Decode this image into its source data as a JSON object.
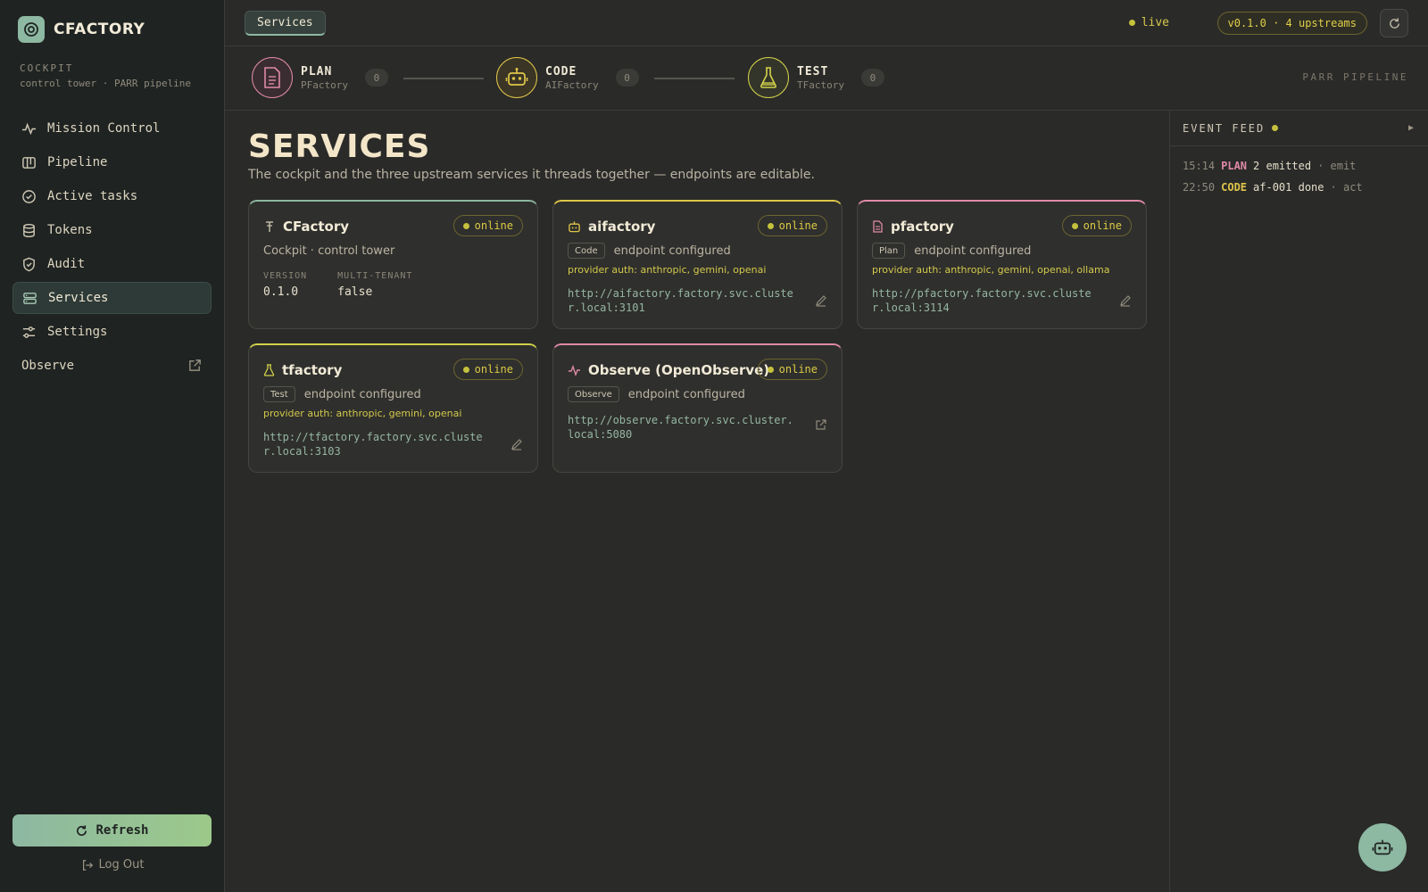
{
  "brand": {
    "name": "CFACTORY"
  },
  "cockpit": {
    "label": "COCKPIT",
    "description": "control tower · PARR pipeline"
  },
  "nav": [
    {
      "label": "Mission Control",
      "icon": "activity-icon"
    },
    {
      "label": "Pipeline",
      "icon": "kanban-icon"
    },
    {
      "label": "Active tasks",
      "icon": "check-circle-icon"
    },
    {
      "label": "Tokens",
      "icon": "database-icon"
    },
    {
      "label": "Audit",
      "icon": "shield-check-icon"
    },
    {
      "label": "Services",
      "icon": "server-icon",
      "active": true
    },
    {
      "label": "Settings",
      "icon": "sliders-icon"
    },
    {
      "label": "Observe",
      "icon": "external-link-icon"
    }
  ],
  "sidebar_footer": {
    "refresh_label": "Refresh",
    "logout_label": "Log Out"
  },
  "topbar": {
    "tab_label": "Services",
    "live_label": "live",
    "version_label": "v0.1.0 · 4 upstreams"
  },
  "pipeline": {
    "label": "PARR PIPELINE",
    "stages": [
      {
        "name": "PLAN",
        "sub": "PFactory",
        "count": "0",
        "color": "#e08aa8",
        "icon": "document-icon"
      },
      {
        "name": "CODE",
        "sub": "AIFactory",
        "count": "0",
        "color": "#e0c64a",
        "icon": "robot-icon"
      },
      {
        "name": "TEST",
        "sub": "TFactory",
        "count": "0",
        "color": "#d2d24a",
        "icon": "flask-icon"
      }
    ]
  },
  "page": {
    "title": "SERVICES",
    "subtitle": "The cockpit and the three upstream services it threads together — endpoints are editable."
  },
  "cards": {
    "cfactory": {
      "title": "CFactory",
      "status": "online",
      "description": "Cockpit · control tower",
      "version_label": "VERSION",
      "version_value": "0.1.0",
      "tenant_label": "MULTI-TENANT",
      "tenant_value": "false",
      "accent": "#8db8a2"
    },
    "aifactory": {
      "title": "aifactory",
      "status": "online",
      "tag": "Code",
      "state": "endpoint configured",
      "auth": "provider auth: anthropic, gemini, openai",
      "endpoint": "http://aifactory.factory.svc.cluster.local:3101",
      "accent": "#e0c64a"
    },
    "pfactory": {
      "title": "pfactory",
      "status": "online",
      "tag": "Plan",
      "state": "endpoint configured",
      "auth": "provider auth: anthropic, gemini, openai, ollama",
      "endpoint": "http://pfactory.factory.svc.cluster.local:3114",
      "accent": "#e08aa8"
    },
    "tfactory": {
      "title": "tfactory",
      "status": "online",
      "tag": "Test",
      "state": "endpoint configured",
      "auth": "provider auth: anthropic, gemini, openai",
      "endpoint": "http://tfactory.factory.svc.cluster.local:3103",
      "accent": "#d2d24a"
    },
    "observe": {
      "title": "Observe (OpenObserve)",
      "status": "online",
      "tag": "Observe",
      "state": "endpoint configured",
      "endpoint": "http://observe.factory.svc.cluster.local:5080",
      "accent": "#e08aa8"
    }
  },
  "feed": {
    "title": "EVENT FEED",
    "events": [
      {
        "time": "15:14",
        "stage": "PLAN",
        "stage_color": "#e08aa8",
        "message": "2 emitted",
        "kind": "· emit"
      },
      {
        "time": "22:50",
        "stage": "CODE",
        "stage_color": "#e0c64a",
        "message": "af-001 done",
        "kind": "· act"
      }
    ]
  }
}
